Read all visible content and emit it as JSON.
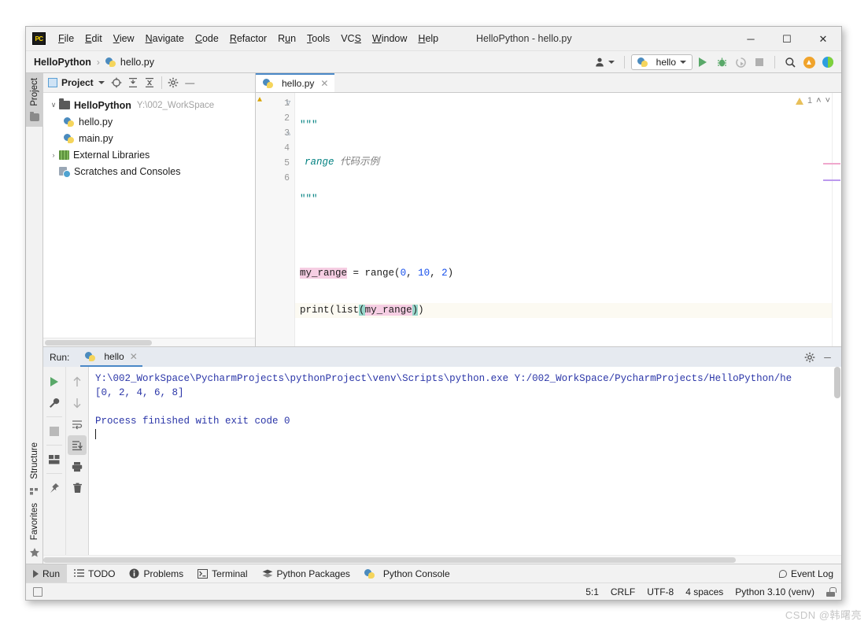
{
  "window": {
    "title": "HelloPython - hello.py",
    "logo_text": "PC",
    "minimize": "─",
    "maximize": "☐",
    "close": "✕"
  },
  "menu": [
    {
      "label": "File"
    },
    {
      "label": "Edit"
    },
    {
      "label": "View"
    },
    {
      "label": "Navigate"
    },
    {
      "label": "Code"
    },
    {
      "label": "Refactor"
    },
    {
      "label": "Run"
    },
    {
      "label": "Tools"
    },
    {
      "label": "VCS"
    },
    {
      "label": "Window"
    },
    {
      "label": "Help"
    }
  ],
  "breadcrumb": {
    "project": "HelloPython",
    "separator": "›",
    "file": "hello.py"
  },
  "toolbar": {
    "run_config": "hello",
    "run_button": "▶",
    "debug_button": "debug-icon",
    "coverage_button": "coverage-icon",
    "stop_button": "stop-icon",
    "search_button": "🔍",
    "update_button": "⬆",
    "share_button": "share-icon"
  },
  "left_rail": {
    "top": "Project",
    "bottom": [
      "Structure",
      "Favorites"
    ]
  },
  "project_panel": {
    "title": "Project",
    "icons": [
      "locate-icon",
      "expand-all-icon",
      "collapse-all-icon",
      "settings-gear-icon",
      "minimize-icon"
    ],
    "tree": [
      {
        "label": "HelloPython",
        "path": "Y:\\002_WorkSpace",
        "bold": true,
        "arrow": "∨",
        "indent": 0,
        "icon": "folder"
      },
      {
        "label": "hello.py",
        "path": "",
        "bold": false,
        "arrow": "",
        "indent": 1,
        "icon": "python"
      },
      {
        "label": "main.py",
        "path": "",
        "bold": false,
        "arrow": "",
        "indent": 1,
        "icon": "python"
      },
      {
        "label": "External Libraries",
        "path": "",
        "bold": false,
        "arrow": "›",
        "indent": 0,
        "icon": "library"
      },
      {
        "label": "Scratches and Consoles",
        "path": "",
        "bold": false,
        "arrow": "",
        "indent": 0,
        "icon": "scratch"
      }
    ]
  },
  "editor": {
    "tab": "hello.py",
    "tab_close": "✕",
    "warning_count": "1",
    "chevron_up": "˄",
    "chevron_down": "˅",
    "lines": [
      {
        "n": "1",
        "text": "\"\"\""
      },
      {
        "n": "2",
        "text": "range 代码示例"
      },
      {
        "n": "3",
        "text": "\"\"\""
      },
      {
        "n": "4",
        "text": ""
      },
      {
        "n": "5",
        "text": "my_range = range(0, 10, 2)"
      },
      {
        "n": "6",
        "text": "print(list(my_range))"
      }
    ],
    "code": {
      "l1": "\"\"\"",
      "l2_kw": "range",
      "l2_cn": " 代码示例",
      "l3": "\"\"\"",
      "l5_var": "my_range",
      "l5_eq": " = ",
      "l5_fn": "range",
      "l5_p1": "(",
      "l5_a": "0",
      "l5_c1": ", ",
      "l5_b": "10",
      "l5_c2": ", ",
      "l5_c": "2",
      "l5_p2": ")",
      "l6_print": "print",
      "l6_p1": "(",
      "l6_list": "list",
      "l6_p2": "(",
      "l6_var": "my_range",
      "l6_p3": ")",
      "l6_p4": ")"
    }
  },
  "run_panel": {
    "label": "Run:",
    "tab": "hello",
    "tab_close": "✕",
    "settings_icon": "gear-icon",
    "minimize_icon": "─",
    "left_tools": [
      "rerun-icon",
      "wrench-icon",
      "stop-icon",
      "layout-icon",
      "pin-icon"
    ],
    "right_tools": [
      "up-arrow-icon",
      "down-arrow-icon",
      "soft-wrap-icon",
      "scroll-to-end-icon",
      "print-icon",
      "trash-icon"
    ],
    "console": [
      "Y:\\002_WorkSpace\\PycharmProjects\\pythonProject\\venv\\Scripts\\python.exe Y:/002_WorkSpace/PycharmProjects/HelloPython/he",
      "[0, 2, 4, 6, 8]",
      "",
      "Process finished with exit code 0"
    ]
  },
  "bottom_tabs": [
    {
      "label": "Run",
      "icon": "run-icon",
      "selected": true
    },
    {
      "label": "TODO",
      "icon": "todo-icon",
      "selected": false
    },
    {
      "label": "Problems",
      "icon": "problems-icon",
      "selected": false
    },
    {
      "label": "Terminal",
      "icon": "terminal-icon",
      "selected": false
    },
    {
      "label": "Python Packages",
      "icon": "packages-icon",
      "selected": false
    },
    {
      "label": "Python Console",
      "icon": "python-console-icon",
      "selected": false
    }
  ],
  "event_log": "Event Log",
  "status_bar": {
    "position": "5:1",
    "line_ending": "CRLF",
    "encoding": "UTF-8",
    "indent": "4 spaces",
    "interpreter": "Python 3.10 (venv)"
  },
  "watermark": "CSDN @韩曙亮",
  "colors": {
    "accent": "#4a88c7",
    "run_green": "#59a869",
    "warning": "#e8c05a",
    "highlight_pink": "#f6cee3",
    "highlight_teal": "#98d8cc"
  }
}
